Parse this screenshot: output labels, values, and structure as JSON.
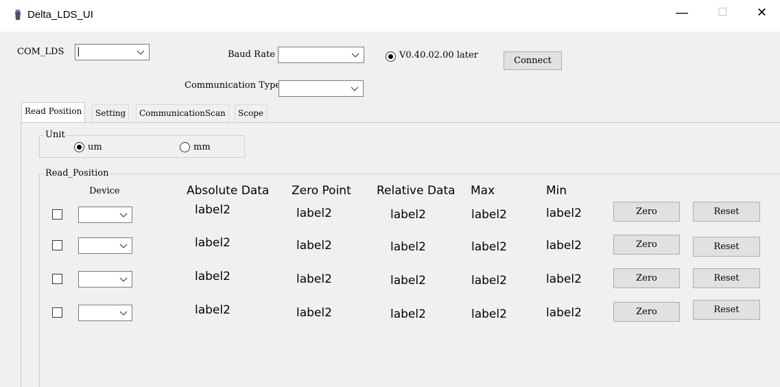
{
  "window": {
    "title": "Delta_LDS_UI",
    "minimize": "—",
    "maximize": "☐",
    "close": "✕"
  },
  "connection": {
    "com_label": "COM_LDS",
    "com_value": "|",
    "baud_label": "Baud Rate",
    "baud_value": "",
    "comm_type_label": "Communication Type",
    "comm_type_value": "",
    "version_option": "V0.40.02.00 later",
    "connect_button": "Connect"
  },
  "tabs": [
    {
      "label": "Read Position",
      "active": true
    },
    {
      "label": "Setting",
      "active": false
    },
    {
      "label": "CommunicationScan",
      "active": false
    },
    {
      "label": "Scope",
      "active": false
    }
  ],
  "unit_group": {
    "title": "Unit",
    "options": [
      {
        "label": "um",
        "selected": true
      },
      {
        "label": "mm",
        "selected": false
      }
    ]
  },
  "read_position": {
    "title": "Read_Position",
    "headers": {
      "device": "Device",
      "absolute": "Absolute Data",
      "zero_point": "Zero Point",
      "relative": "Relative Data",
      "max": "Max",
      "min": "Min"
    },
    "rows": [
      {
        "absolute": "label2",
        "zero_point": "label2",
        "relative": "label2",
        "max": "label2",
        "min": "label2",
        "zero_btn": "Zero",
        "reset_btn": "Reset"
      },
      {
        "absolute": "label2",
        "zero_point": "label2",
        "relative": "label2",
        "max": "label2",
        "min": "label2",
        "zero_btn": "Zero",
        "reset_btn": "Reset"
      },
      {
        "absolute": "label2",
        "zero_point": "label2",
        "relative": "label2",
        "max": "label2",
        "min": "label2",
        "zero_btn": "Zero",
        "reset_btn": "Reset"
      },
      {
        "absolute": "label2",
        "zero_point": "label2",
        "relative": "label2",
        "max": "label2",
        "min": "label2",
        "zero_btn": "Zero",
        "reset_btn": "Reset"
      }
    ]
  },
  "colors": {
    "window_bg": "#f0f0f0",
    "titlebar_bg": "#ffffff",
    "button_bg": "#e1e1e1",
    "button_border": "#adadad"
  },
  "icons": {
    "app": "app-icon",
    "dropdown": "chevron-down-icon"
  }
}
